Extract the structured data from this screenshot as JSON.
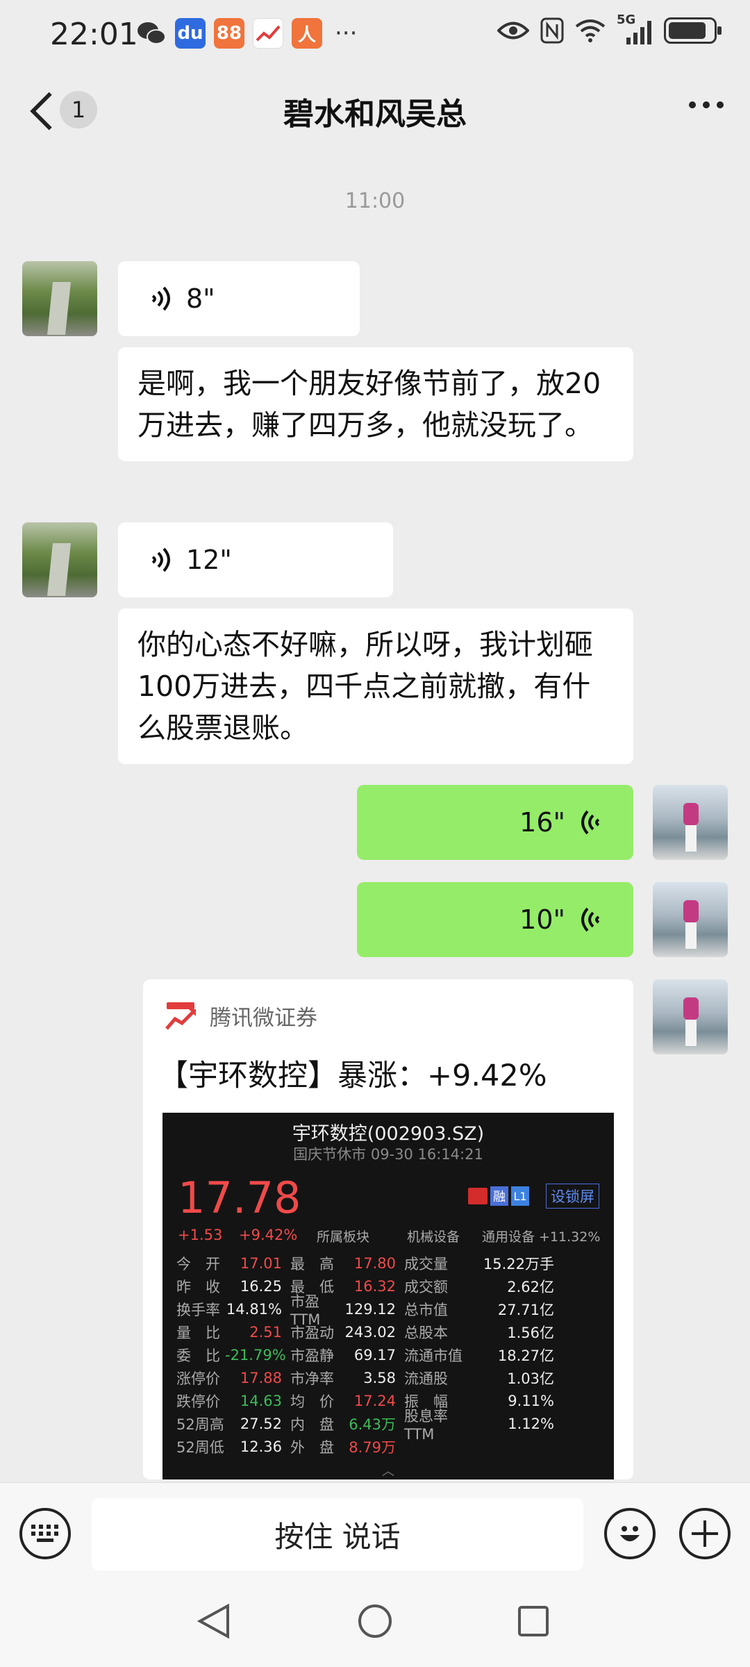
{
  "status_bar": {
    "time": "22:01",
    "network": "5G",
    "apps": [
      {
        "name": "wechat-icon"
      },
      {
        "name": "baidu-icon"
      },
      {
        "name": "app-88-icon"
      },
      {
        "name": "stock-app-icon"
      },
      {
        "name": "person-app-icon"
      }
    ],
    "more": "···",
    "battery_level": 0.85
  },
  "header": {
    "back_label": "<",
    "unread_count": "1",
    "title": "碧水和风吴总",
    "more_label": "···"
  },
  "chat": {
    "timestamp": "11:00",
    "messages": [
      {
        "from": "other",
        "type": "voice",
        "duration": "8\""
      },
      {
        "from": "other",
        "type": "text",
        "text": "是啊，我一个朋友好像节前了，放20万进去，赚了四万多，他就没玩了。"
      },
      {
        "from": "other",
        "type": "voice",
        "duration": "12\""
      },
      {
        "from": "other",
        "type": "text",
        "text": "你的心态不好嘛，所以呀，我计划砸100万进去，四千点之前就撤，有什么股票退账。"
      },
      {
        "from": "self",
        "type": "voice",
        "duration": "16\""
      },
      {
        "from": "self",
        "type": "voice",
        "duration": "10\""
      }
    ]
  },
  "share_card": {
    "source": "腾讯微证券",
    "title": "【宇环数控】暴涨：+9.42%",
    "stock": {
      "name": "宇环数控(002903.SZ)",
      "subtitle": "国庆节休市 09-30 16:14:21",
      "price": "17.78",
      "change": "+1.53",
      "change_pct": "+9.42%",
      "tag_rong": "融",
      "tag_l1": "L1",
      "lock_label": "设锁屏",
      "sector_label": "所属板块",
      "sector_name": "机械设备",
      "sector_sub": "通用设备 +11.32%",
      "rows": [
        [
          {
            "l": "今　开",
            "v": "17.01",
            "c": "red"
          },
          {
            "l": "最　高",
            "v": "17.80",
            "c": "red"
          },
          {
            "l": "成交量",
            "v": "15.22万手",
            "c": "white"
          }
        ],
        [
          {
            "l": "昨　收",
            "v": "16.25",
            "c": "white"
          },
          {
            "l": "最　低",
            "v": "16.32",
            "c": "red"
          },
          {
            "l": "成交额",
            "v": "2.62亿",
            "c": "white"
          }
        ],
        [
          {
            "l": "换手率",
            "v": "14.81%",
            "c": "white"
          },
          {
            "l": "市盈TTM",
            "v": "129.12",
            "c": "white"
          },
          {
            "l": "总市值",
            "v": "27.71亿",
            "c": "white"
          }
        ],
        [
          {
            "l": "量　比",
            "v": "2.51",
            "c": "red"
          },
          {
            "l": "市盈动",
            "v": "243.02",
            "c": "white"
          },
          {
            "l": "总股本",
            "v": "1.56亿",
            "c": "white"
          }
        ],
        [
          {
            "l": "委　比",
            "v": "-21.79%",
            "c": "green"
          },
          {
            "l": "市盈静",
            "v": "69.17",
            "c": "white"
          },
          {
            "l": "流通市值",
            "v": "18.27亿",
            "c": "white"
          }
        ],
        [
          {
            "l": "涨停价",
            "v": "17.88",
            "c": "red"
          },
          {
            "l": "市净率",
            "v": "3.58",
            "c": "white"
          },
          {
            "l": "流通股",
            "v": "1.03亿",
            "c": "white"
          }
        ],
        [
          {
            "l": "跌停价",
            "v": "14.63",
            "c": "green"
          },
          {
            "l": "均　价",
            "v": "17.24",
            "c": "red"
          },
          {
            "l": "振　幅",
            "v": "9.11%",
            "c": "white"
          }
        ],
        [
          {
            "l": "52周高",
            "v": "27.52",
            "c": "white"
          },
          {
            "l": "内　盘",
            "v": "6.43万",
            "c": "green"
          },
          {
            "l": "股息率TTM",
            "v": "1.12%",
            "c": "white"
          }
        ],
        [
          {
            "l": "52周低",
            "v": "12.36",
            "c": "white"
          },
          {
            "l": "外　盘",
            "v": "8.79万",
            "c": "red"
          },
          {
            "l": "",
            "v": "",
            "c": "white"
          }
        ]
      ]
    }
  },
  "input_bar": {
    "talk_label": "按住 说话"
  },
  "colors": {
    "self_bubble": "#95ec69",
    "background": "#ededed",
    "price_up": "#f04a4a",
    "price_down": "#3dbb5a"
  }
}
